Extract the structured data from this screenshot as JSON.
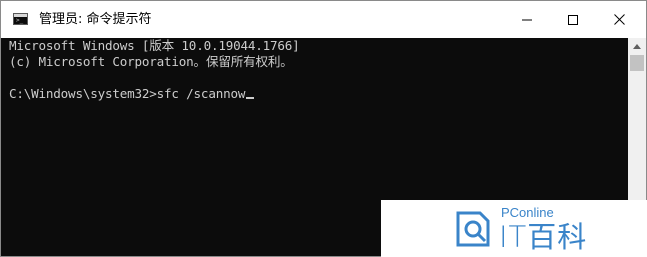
{
  "window": {
    "title": "管理员: 命令提示符",
    "icon": "command-prompt-icon",
    "controls": {
      "minimize": "minimize-icon",
      "maximize": "maximize-icon",
      "close": "close-icon"
    }
  },
  "terminal": {
    "lines": [
      "Microsoft Windows [版本 10.0.19044.1766]",
      "(c) Microsoft Corporation。保留所有权利。",
      "C:\\Windows\\system32>sfc /scannow"
    ]
  },
  "watermark": {
    "brand": "PConline",
    "name": "IT百科",
    "accent_color": "#3a84c9"
  },
  "colors": {
    "terminal_bg": "#0c0c0c",
    "terminal_fg": "#cccccc",
    "titlebar_bg": "#ffffff"
  }
}
